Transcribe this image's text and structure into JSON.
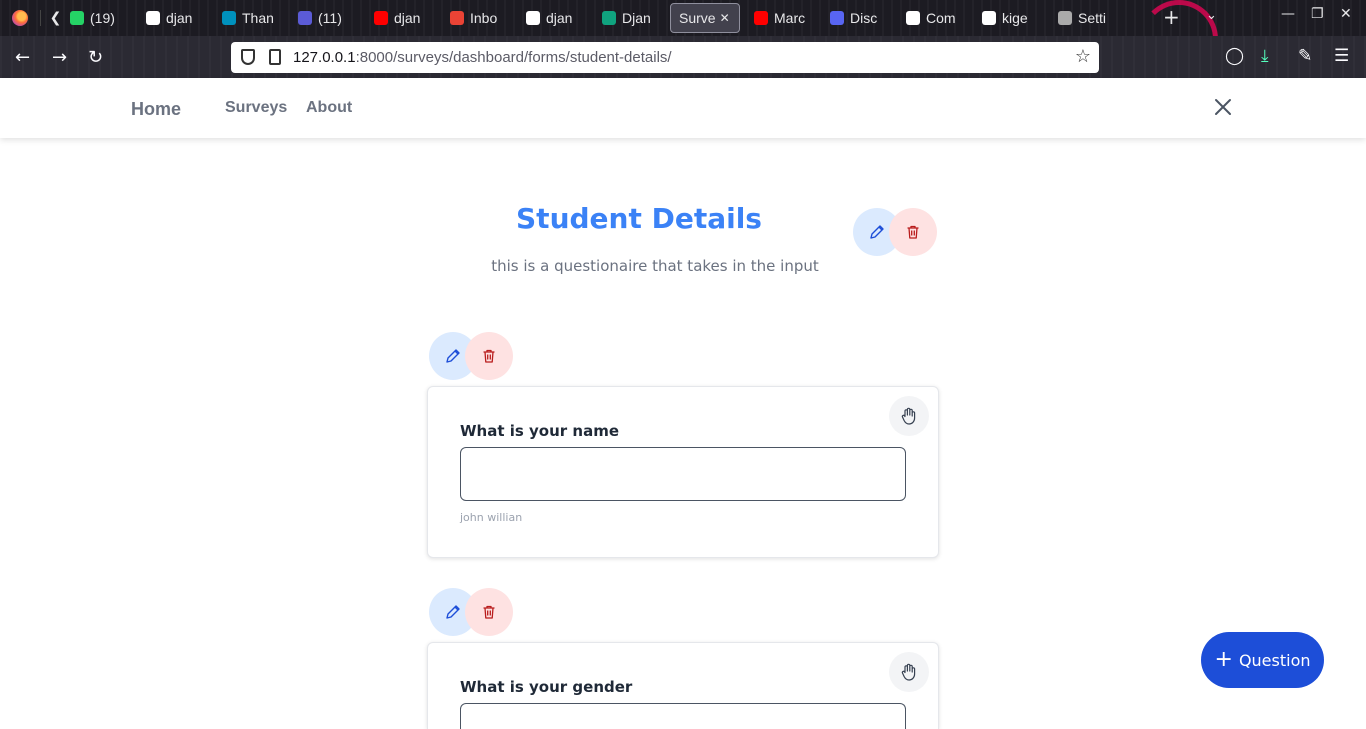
{
  "browser": {
    "tabs": [
      {
        "label": "(19)",
        "icon": "whatsapp-icon",
        "color": "#25d366"
      },
      {
        "label": "djan",
        "icon": "page-icon",
        "color": "#ffffff"
      },
      {
        "label": "Than",
        "icon": "arm-icon",
        "color": "#0091bd"
      },
      {
        "label": "(11)",
        "icon": "calendar-icon",
        "color": "#5b5bd6"
      },
      {
        "label": "djan",
        "icon": "youtube-icon",
        "color": "#ff0000"
      },
      {
        "label": "Inbo",
        "icon": "gmail-icon",
        "color": "#ea4335"
      },
      {
        "label": "djan",
        "icon": "page-icon",
        "color": "#ffffff"
      },
      {
        "label": "Djan",
        "icon": "chatgpt-icon",
        "color": "#10a37f"
      },
      {
        "label": "Surve",
        "icon": "",
        "color": "",
        "active": true
      },
      {
        "label": "Marc",
        "icon": "youtube-icon",
        "color": "#ff0000"
      },
      {
        "label": "Disc",
        "icon": "discord-icon",
        "color": "#5865f2"
      },
      {
        "label": "Com",
        "icon": "github-icon",
        "color": "#ffffff"
      },
      {
        "label": "kige",
        "icon": "github-icon",
        "color": "#ffffff"
      },
      {
        "label": "Setti",
        "icon": "settings-mask-icon",
        "color": "#aaaaaa"
      }
    ],
    "url_host": "127.0.0.1",
    "url_rest": ":8000/surveys/dashboard/forms/student-details/"
  },
  "nav": {
    "home": "Home",
    "surveys": "Surveys",
    "about": "About"
  },
  "form": {
    "title": "Student Details",
    "description": "this is a questionaire that takes in the input"
  },
  "questions": [
    {
      "label": "What is your name",
      "hint": "john willian"
    },
    {
      "label": "What is your gender",
      "hint": ""
    }
  ],
  "add_question": {
    "label": "Question"
  },
  "colors": {
    "accent": "#3b82f6",
    "primary_button": "#1d4ed8",
    "edit_bg": "#dbeafe",
    "delete_bg": "#fee2e2"
  }
}
